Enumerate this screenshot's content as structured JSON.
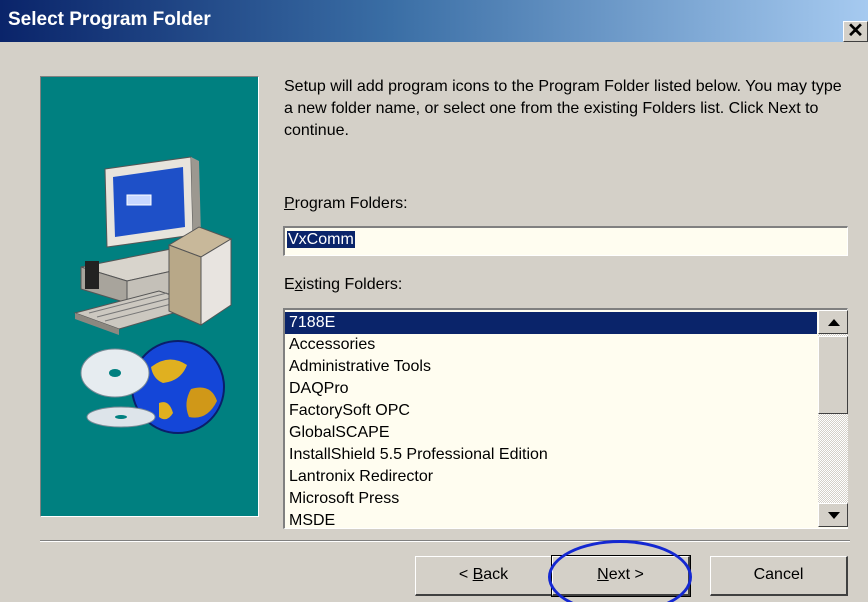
{
  "window": {
    "title": "Select Program Folder",
    "close_label": "✕"
  },
  "description": "Setup will add program icons to the Program Folder listed below.  You may type a new folder name, or select one from the existing Folders list.  Click Next to continue.",
  "program_folders": {
    "label_underlined": "P",
    "label_rest": "rogram Folders:",
    "value": "VxComm"
  },
  "existing_folders": {
    "label_pre": "E",
    "label_underlined": "x",
    "label_rest": "isting Folders:",
    "items": [
      "7188E",
      "Accessories",
      "Administrative Tools",
      "DAQPro",
      "FactorySoft OPC",
      "GlobalSCAPE",
      "InstallShield 5.5 Professional Edition",
      "Lantronix Redirector",
      "Microsoft Press",
      "MSDE"
    ],
    "selected_index": 0
  },
  "buttons": {
    "back_prefix": "< ",
    "back_underlined": "B",
    "back_rest": "ack",
    "next_underlined": "N",
    "next_rest": "ext >",
    "cancel": "Cancel"
  },
  "colors": {
    "title_gradient_start": "#0a246a",
    "selection": "#0a246a",
    "art_background": "#008080",
    "highlight_circle": "#1428d2"
  }
}
